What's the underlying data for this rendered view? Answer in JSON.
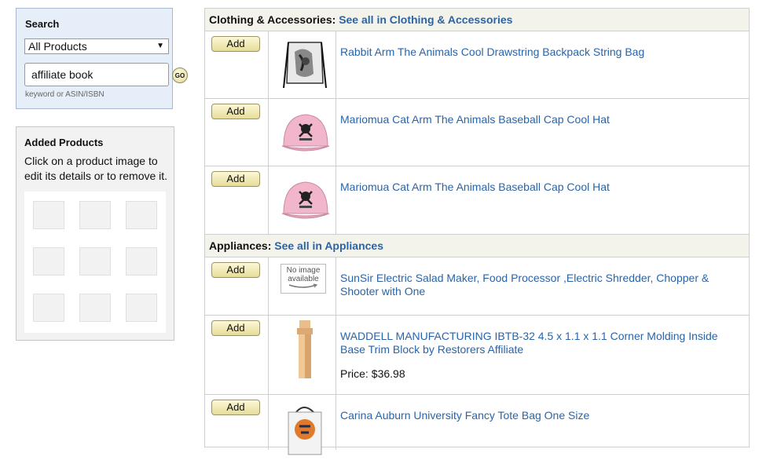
{
  "search": {
    "title": "Search",
    "category": "All Products",
    "query": "affiliate book",
    "go_label": "GO",
    "hint": "keyword or ASIN/ISBN"
  },
  "added": {
    "title": "Added Products",
    "help": "Click on a product image to edit its details or to remove it."
  },
  "categories": [
    {
      "name": "Clothing & Accessories:",
      "link": "See all in Clothing & Accessories",
      "products": [
        {
          "add": "Add",
          "title": "Rabbit Arm The Animals Cool Drawstring Backpack String Bag",
          "image": "drawstring-bag-image"
        },
        {
          "add": "Add",
          "title": "Mariomua Cat Arm The Animals Baseball Cap Cool Hat",
          "image": "pink-cap-image"
        },
        {
          "add": "Add",
          "title": "Mariomua Cat Arm The Animals Baseball Cap Cool Hat",
          "image": "pink-cap-image"
        }
      ]
    },
    {
      "name": "Appliances:",
      "link": "See all in Appliances",
      "products": [
        {
          "add": "Add",
          "title": "SunSir Electric Salad Maker, Food Processor ,Electric Shredder, Chopper & Shooter with One",
          "image": "no-image-placeholder",
          "no_image_line1": "No image",
          "no_image_line2": "available"
        },
        {
          "add": "Add",
          "title": "WADDELL MANUFACTURING IBTB-32 4.5 x 1.1 x 1.1 Corner Molding Inside Base Trim Block by Restorers Affiliate",
          "image": "wood-trim-block-image",
          "price_label": "Price:",
          "price": "$36.98"
        },
        {
          "add": "Add",
          "title": "Carina Auburn University Fancy Tote Bag One Size",
          "image": "tote-bag-image"
        }
      ]
    }
  ],
  "colors": {
    "link": "#2a64a8",
    "search_bg": "#e6eef9",
    "header_bg": "#f3f3ec"
  }
}
